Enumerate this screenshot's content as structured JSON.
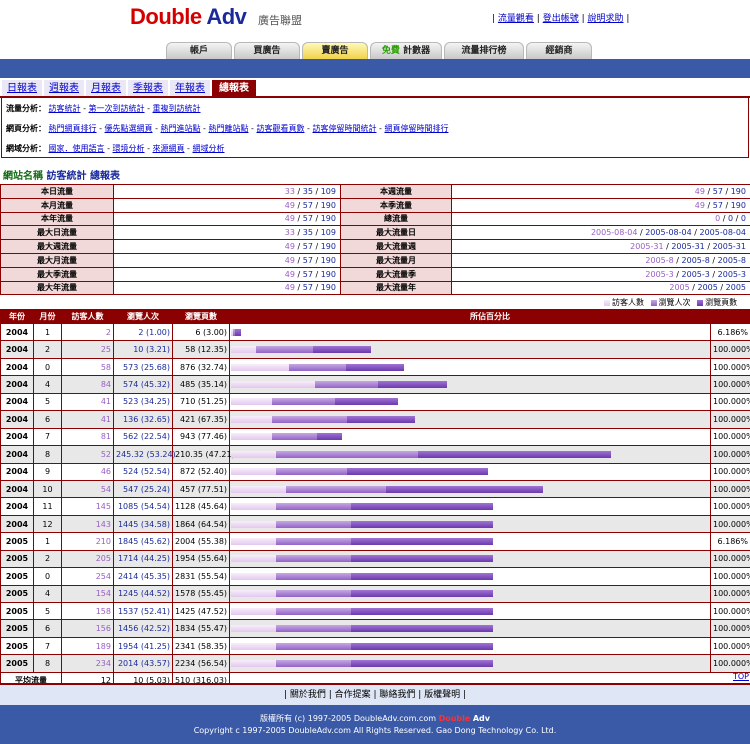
{
  "header": {
    "logo_double": "Double",
    "logo_adv": "Adv",
    "logo_sub": "廣告聯盟",
    "links": [
      "流量觀看",
      "登出帳號",
      "說明求助"
    ]
  },
  "nav": {
    "tabs": [
      {
        "label": "帳戶"
      },
      {
        "label": "買廣告"
      },
      {
        "label": "賣廣告",
        "active": true
      },
      {
        "free": "免費",
        "label": "計數器"
      },
      {
        "label": "流量排行榜"
      },
      {
        "label": "經銷商"
      }
    ]
  },
  "report_tabs": [
    "日報表",
    "週報表",
    "月報表",
    "季報表",
    "年報表",
    "總報表"
  ],
  "analysis": {
    "traffic": {
      "title": "流量分析：",
      "links": [
        "訪客統計",
        "第一次到訪統計",
        "重複到訪統計"
      ]
    },
    "page": {
      "title": "網頁分析：",
      "links": [
        "熱門網頁排行",
        "優先點選網頁",
        "熱門進站點",
        "熱門離站點",
        "訪客觀看頁數",
        "訪客停留時間統計",
        "網頁停留時間排行"
      ]
    },
    "region": {
      "title": "網域分析：",
      "links": [
        "國家．使用語言",
        "環境分析",
        "來源網頁",
        "網域分析"
      ]
    }
  },
  "title": {
    "site": "網站名稱",
    "rest": "訪客統計 總報表"
  },
  "summary": {
    "rows": [
      {
        "l1": "本日流量",
        "v1": [
          "33",
          "35",
          "109"
        ],
        "l2": "本週流量",
        "v2": [
          "49",
          "57",
          "190"
        ]
      },
      {
        "l1": "本月流量",
        "v1": [
          "49",
          "57",
          "190"
        ],
        "l2": "本季流量",
        "v2": [
          "49",
          "57",
          "190"
        ]
      },
      {
        "l1": "本年流量",
        "v1": [
          "49",
          "57",
          "190"
        ],
        "l2": "總流量",
        "v2": [
          "0",
          "0",
          "0"
        ]
      },
      {
        "l1": "最大日流量",
        "v1": [
          "33",
          "35",
          "109"
        ],
        "l2": "最大流量日",
        "v2": [
          "2005-08-04",
          "2005-08-04",
          "2005-08-04"
        ]
      },
      {
        "l1": "最大週流量",
        "v1": [
          "49",
          "57",
          "190"
        ],
        "l2": "最大流量週",
        "v2": [
          "2005-31",
          "2005-31",
          "2005-31"
        ]
      },
      {
        "l1": "最大月流量",
        "v1": [
          "49",
          "57",
          "190"
        ],
        "l2": "最大流量月",
        "v2": [
          "2005-8",
          "2005-8",
          "2005-8"
        ]
      },
      {
        "l1": "最大季流量",
        "v1": [
          "49",
          "57",
          "190"
        ],
        "l2": "最大流量季",
        "v2": [
          "2005-3",
          "2005-3",
          "2005-3"
        ]
      },
      {
        "l1": "最大年流量",
        "v1": [
          "49",
          "57",
          "190"
        ],
        "l2": "最大流量年",
        "v2": [
          "2005",
          "2005",
          "2005"
        ]
      }
    ]
  },
  "legend": [
    "訪客人數",
    "瀏覽人次",
    "瀏覽頁數"
  ],
  "colors": {
    "visitors": "#e2c8ee",
    "sessions": "#9163c8",
    "pages": "#6b3aae",
    "header": "#8b0000",
    "blue": "#3a5aa8"
  },
  "table": {
    "headers": [
      "年份",
      "月份",
      "訪客人數",
      "瀏覽人次",
      "瀏覽頁數",
      "所佔百分比"
    ],
    "rows": [
      {
        "year": "2004",
        "month": "1",
        "visitors": "2",
        "sessions": "2 (1.00)",
        "pages": "6 (3.00)",
        "pct": "6.186%",
        "bar": [
          2,
          2,
          6
        ]
      },
      {
        "year": "2004",
        "month": "2",
        "visitors": "25",
        "sessions": "10 (3.21)",
        "pages": "58 (12.35)",
        "pct": "100.000%",
        "bar": [
          25,
          57,
          58
        ]
      },
      {
        "year": "2004",
        "month": "0",
        "visitors": "58",
        "sessions": "573 (25.68)",
        "pages": "876 (32.74)",
        "pct": "100.000%",
        "bar": [
          58,
          57,
          58
        ]
      },
      {
        "year": "2004",
        "month": "4",
        "visitors": "84",
        "sessions": "574 (45.32)",
        "pages": "485 (35.14)",
        "pct": "100.000%",
        "bar": [
          84,
          63,
          69
        ]
      },
      {
        "year": "2004",
        "month": "5",
        "visitors": "41",
        "sessions": "523 (34.25)",
        "pages": "710 (51.25)",
        "pct": "100.000%",
        "bar": [
          41,
          63,
          63
        ]
      },
      {
        "year": "2004",
        "month": "6",
        "visitors": "41",
        "sessions": "136 (32.65)",
        "pages": "421 (67.35)",
        "pct": "100.000%",
        "bar": [
          41,
          75,
          68
        ]
      },
      {
        "year": "2004",
        "month": "7",
        "visitors": "81",
        "sessions": "562 (22.54)",
        "pages": "943 (77.46)",
        "pct": "100.000%",
        "bar": [
          41,
          45,
          25
        ]
      },
      {
        "year": "2004",
        "month": "8",
        "visitors": "52",
        "sessions": "245.32 (53.24)",
        "pages": "210.35 (47.21)",
        "pct": "100.000%",
        "bar": [
          45,
          142,
          193
        ]
      },
      {
        "year": "2004",
        "month": "9",
        "visitors": "46",
        "sessions": "524 (52.54)",
        "pages": "872 (52.40)",
        "pct": "100.000%",
        "bar": [
          45,
          71,
          141
        ]
      },
      {
        "year": "2004",
        "month": "10",
        "visitors": "54",
        "sessions": "547 (25.24)",
        "pages": "457 (77.51)",
        "pct": "100.000%",
        "bar": [
          55,
          100,
          157
        ]
      },
      {
        "year": "2004",
        "month": "11",
        "visitors": "145",
        "sessions": "1085 (54.54)",
        "pages": "1128 (45.64)",
        "pct": "100.000%",
        "bar": [
          45,
          75,
          142
        ]
      },
      {
        "year": "2004",
        "month": "12",
        "visitors": "143",
        "sessions": "1445 (34.58)",
        "pages": "1864 (64.54)",
        "pct": "100.000%",
        "bar": [
          45,
          75,
          142
        ]
      },
      {
        "year": "2005",
        "month": "1",
        "visitors": "210",
        "sessions": "1845 (45.62)",
        "pages": "2004 (55.38)",
        "pct": "6.186%",
        "bar": [
          45,
          75,
          142
        ]
      },
      {
        "year": "2005",
        "month": "2",
        "visitors": "205",
        "sessions": "1714 (44.25)",
        "pages": "1954 (55.64)",
        "pct": "100.000%",
        "bar": [
          45,
          75,
          142
        ]
      },
      {
        "year": "2005",
        "month": "0",
        "visitors": "254",
        "sessions": "2414 (45.35)",
        "pages": "2831 (55.54)",
        "pct": "100.000%",
        "bar": [
          45,
          75,
          142
        ]
      },
      {
        "year": "2005",
        "month": "4",
        "visitors": "154",
        "sessions": "1245 (44.52)",
        "pages": "1578 (55.45)",
        "pct": "100.000%",
        "bar": [
          45,
          75,
          142
        ]
      },
      {
        "year": "2005",
        "month": "5",
        "visitors": "158",
        "sessions": "1537 (52.41)",
        "pages": "1425 (47.52)",
        "pct": "100.000%",
        "bar": [
          45,
          75,
          142
        ]
      },
      {
        "year": "2005",
        "month": "6",
        "visitors": "156",
        "sessions": "1456 (42.52)",
        "pages": "1834 (55.47)",
        "pct": "100.000%",
        "bar": [
          45,
          75,
          142
        ]
      },
      {
        "year": "2005",
        "month": "7",
        "visitors": "189",
        "sessions": "1954 (41.25)",
        "pages": "2341 (58.35)",
        "pct": "100.000%",
        "bar": [
          45,
          75,
          142
        ]
      },
      {
        "year": "2005",
        "month": "8",
        "visitors": "234",
        "sessions": "2014 (43.57)",
        "pages": "2234 (56.54)",
        "pct": "100.000%",
        "bar": [
          45,
          75,
          142
        ]
      }
    ],
    "average": {
      "label": "平均流量",
      "visitors": "12",
      "sessions": "10 (5.03)",
      "pages": "510 (316.03)"
    }
  },
  "top_link": "TOP",
  "footer": {
    "links": [
      "關於我們",
      "合作提案",
      "聯絡我們",
      "版權聲明"
    ],
    "copyright1": "版權所有 (c) 1997-2005 DoubleAdv.com.com",
    "copy_double": "Double",
    "copy_adv": "Adv",
    "copyright2": "Copyright c 1997-2005 DoubleAdv.com All Rights Reserved. Gao Dong Technology Co. Ltd."
  }
}
